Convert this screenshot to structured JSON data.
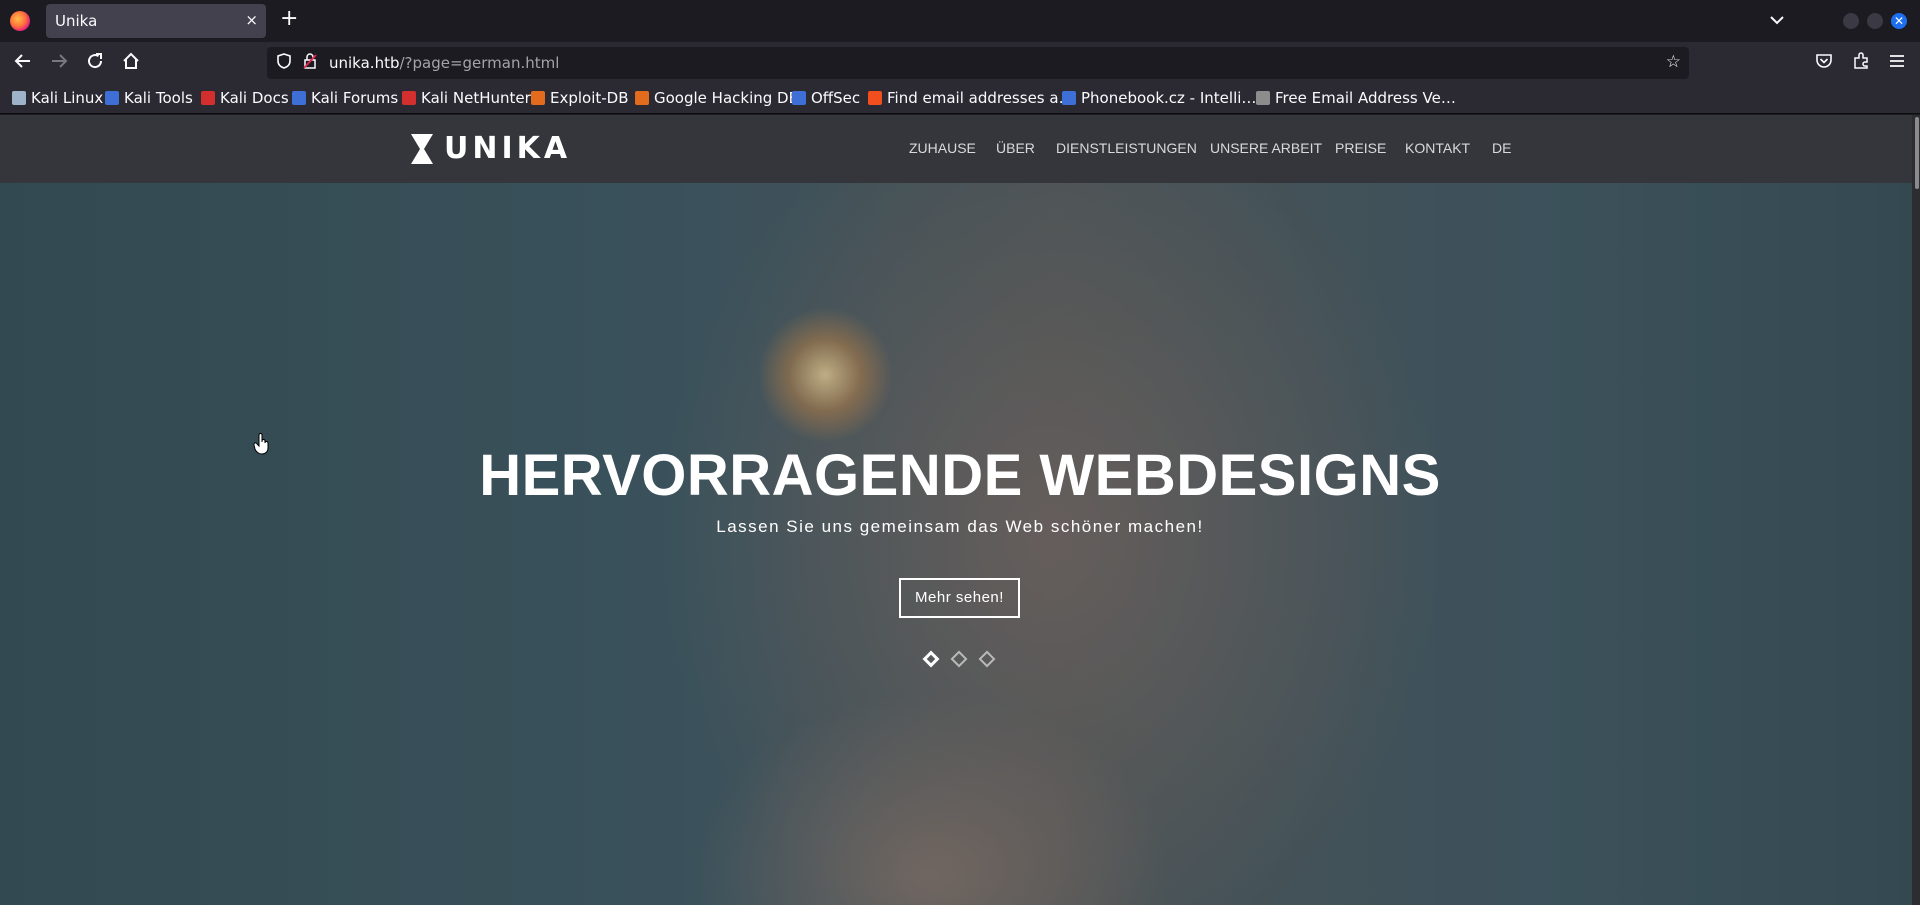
{
  "browser": {
    "tab_title": "Unika",
    "tab_close": "×",
    "new_tab": "+",
    "tab_list": "⌄",
    "url_host": "unika.htb",
    "url_path": "/?page=german.html",
    "bookmarks": [
      {
        "label": "Kali Linux",
        "icon_color": "#9fb3c8"
      },
      {
        "label": "Kali Tools",
        "icon_color": "#3d6fd6"
      },
      {
        "label": "Kali Docs",
        "icon_color": "#d32f2f"
      },
      {
        "label": "Kali Forums",
        "icon_color": "#3d6fd6"
      },
      {
        "label": "Kali NetHunter",
        "icon_color": "#d32f2f"
      },
      {
        "label": "Exploit-DB",
        "icon_color": "#e36b1e"
      },
      {
        "label": "Google Hacking DB",
        "icon_color": "#e36b1e"
      },
      {
        "label": "OffSec",
        "icon_color": "#3d6fd6"
      },
      {
        "label": "Find email addresses a…",
        "icon_color": "#f24e1e"
      },
      {
        "label": "Phonebook.cz - Intelli…",
        "icon_color": "#3d6fd6"
      },
      {
        "label": "Free Email Address Ve…",
        "icon_color": "#8c8c8c"
      }
    ]
  },
  "site": {
    "logo_text": "UNIKA",
    "menu": [
      "ZUHAUSE",
      "ÜBER",
      "DIENSTLEISTUNGEN",
      "UNSERE ARBEIT",
      "PREISE",
      "KONTAKT",
      "DE"
    ],
    "hero_title": "HERVORRAGENDE WEBDESIGNS",
    "hero_subtitle": "Lassen Sie uns gemeinsam das Web schöner machen!",
    "hero_button": "Mehr sehen!",
    "slides": 3,
    "active_slide": 1
  }
}
